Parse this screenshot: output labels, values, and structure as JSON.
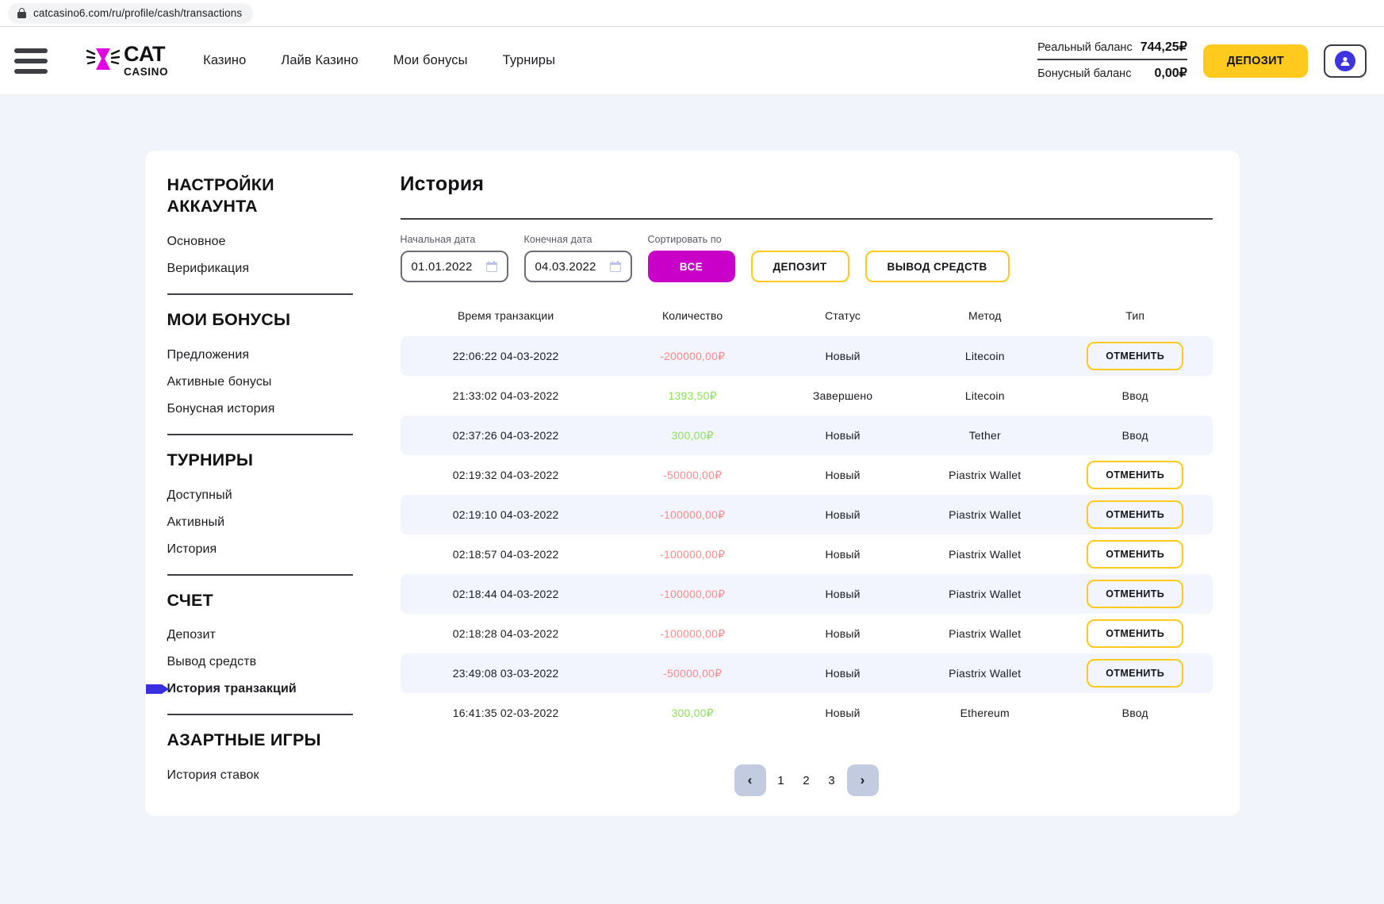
{
  "browser": {
    "url": "catcasino6.com/ru/profile/cash/transactions",
    "lock_icon": "lock-icon"
  },
  "header": {
    "menu_icon": "hamburger-icon",
    "logo": {
      "name": "CAT",
      "sub": "CASINO"
    },
    "nav": [
      {
        "label": "Казино"
      },
      {
        "label": "Лайв Казино"
      },
      {
        "label": "Мои бонусы"
      },
      {
        "label": "Турниры"
      }
    ],
    "balances": {
      "real_label": "Реальный баланс",
      "real_value": "744,25₽",
      "bonus_label": "Бонусный баланс",
      "bonus_value": "0,00₽"
    },
    "deposit_button": "ДЕПОЗИТ",
    "avatar_icon": "user-avatar-icon"
  },
  "sidebar": {
    "groups": [
      {
        "title": "НАСТРОЙКИ АККАУНТА",
        "items": [
          {
            "label": "Основное",
            "active": false
          },
          {
            "label": "Верификация",
            "active": false
          }
        ]
      },
      {
        "title": "МОИ БОНУСЫ",
        "items": [
          {
            "label": "Предложения",
            "active": false
          },
          {
            "label": "Активные бонусы",
            "active": false
          },
          {
            "label": "Бонусная история",
            "active": false
          }
        ]
      },
      {
        "title": "ТУРНИРЫ",
        "items": [
          {
            "label": "Доступный",
            "active": false
          },
          {
            "label": "Активный",
            "active": false
          },
          {
            "label": "История",
            "active": false
          }
        ]
      },
      {
        "title": "СЧЕТ",
        "items": [
          {
            "label": "Депозит",
            "active": false
          },
          {
            "label": "Вывод средств",
            "active": false
          },
          {
            "label": "История транзакций",
            "active": true
          }
        ]
      },
      {
        "title": "АЗАРТНЫЕ ИГРЫ",
        "items": [
          {
            "label": "История ставок",
            "active": false
          }
        ]
      }
    ]
  },
  "main": {
    "title": "История",
    "filters": {
      "start_date_label": "Начальная дата",
      "start_date_value": "01.01.2022",
      "end_date_label": "Конечная дата",
      "end_date_value": "04.03.2022",
      "sort_label": "Сортировать по",
      "all_button": "ВСЕ",
      "deposit_button": "ДЕПОЗИТ",
      "withdraw_button": "ВЫВОД СРЕДСТВ",
      "calendar_icon": "calendar-icon"
    },
    "table": {
      "columns": [
        "Время транзакции",
        "Количество",
        "Статус",
        "Метод",
        "Тип"
      ],
      "cancel_label": "ОТМЕНИТЬ",
      "rows": [
        {
          "time": "22:06:22 04-03-2022",
          "amount": "-200000,00₽",
          "sign": "neg",
          "status": "Новый",
          "method": "Litecoin",
          "type": "ОТМЕНИТЬ",
          "type_is_button": true
        },
        {
          "time": "21:33:02 04-03-2022",
          "amount": "1393,50₽",
          "sign": "pos",
          "status": "Завершено",
          "method": "Litecoin",
          "type": "Ввод",
          "type_is_button": false
        },
        {
          "time": "02:37:26 04-03-2022",
          "amount": "300,00₽",
          "sign": "pos",
          "status": "Новый",
          "method": "Tether",
          "type": "Ввод",
          "type_is_button": false
        },
        {
          "time": "02:19:32 04-03-2022",
          "amount": "-50000,00₽",
          "sign": "neg",
          "status": "Новый",
          "method": "Piastrix Wallet",
          "type": "ОТМЕНИТЬ",
          "type_is_button": true
        },
        {
          "time": "02:19:10 04-03-2022",
          "amount": "-100000,00₽",
          "sign": "neg",
          "status": "Новый",
          "method": "Piastrix Wallet",
          "type": "ОТМЕНИТЬ",
          "type_is_button": true
        },
        {
          "time": "02:18:57 04-03-2022",
          "amount": "-100000,00₽",
          "sign": "neg",
          "status": "Новый",
          "method": "Piastrix Wallet",
          "type": "ОТМЕНИТЬ",
          "type_is_button": true
        },
        {
          "time": "02:18:44 04-03-2022",
          "amount": "-100000,00₽",
          "sign": "neg",
          "status": "Новый",
          "method": "Piastrix Wallet",
          "type": "ОТМЕНИТЬ",
          "type_is_button": true
        },
        {
          "time": "02:18:28 04-03-2022",
          "amount": "-100000,00₽",
          "sign": "neg",
          "status": "Новый",
          "method": "Piastrix Wallet",
          "type": "ОТМЕНИТЬ",
          "type_is_button": true
        },
        {
          "time": "23:49:08 03-03-2022",
          "amount": "-50000,00₽",
          "sign": "neg",
          "status": "Новый",
          "method": "Piastrix Wallet",
          "type": "ОТМЕНИТЬ",
          "type_is_button": true
        },
        {
          "time": "16:41:35 02-03-2022",
          "amount": "300,00₽",
          "sign": "pos",
          "status": "Новый",
          "method": "Ethereum",
          "type": "Ввод",
          "type_is_button": false
        }
      ]
    },
    "pagination": {
      "prev_icon": "chevron-left-icon",
      "next_icon": "chevron-right-icon",
      "pages": [
        "1",
        "2",
        "3"
      ],
      "current": "1"
    }
  },
  "colors": {
    "accent_yellow": "#ffc91d",
    "accent_magenta": "#c800c8",
    "accent_blue": "#3d34e0",
    "negative": "#ff8a8a",
    "positive": "#8ce05a",
    "row_alt": "#f2f5fd",
    "page_bg": "#f2f4fb"
  }
}
